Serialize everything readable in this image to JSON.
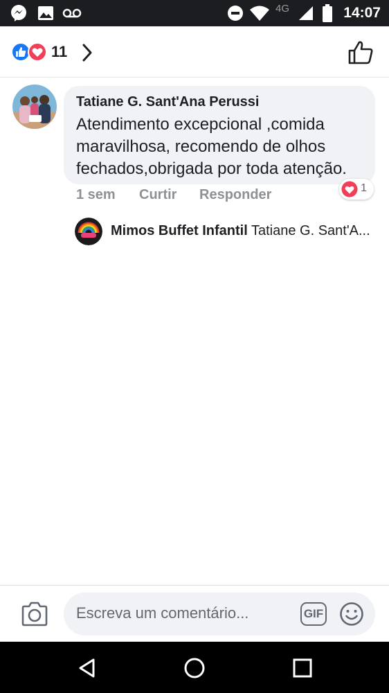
{
  "status_bar": {
    "time": "14:07",
    "network": "4G",
    "icons": [
      "messenger-icon",
      "image-icon",
      "voicemail-icon",
      "do-not-disturb-icon",
      "wifi-icon",
      "signal-icon",
      "battery-icon"
    ]
  },
  "header": {
    "reaction_icons": [
      "like-icon",
      "love-icon"
    ],
    "reaction_count": "11"
  },
  "comment": {
    "author": "Tatiane G. Sant'Ana Perussi",
    "text": "Atendimento excepcional ,comida maravilhosa, recomendo de olhos fechados,obrigada por toda atenção.",
    "time": "1 sem",
    "like_label": "Curtir",
    "reply_label": "Responder",
    "reaction_count": "1"
  },
  "reply": {
    "author": "Mimos Buffet Infantil",
    "text": "Tatiane G. Sant'A..."
  },
  "composer": {
    "placeholder": "Escreva um comentário...",
    "gif_label": "GIF"
  },
  "colors": {
    "status_bar_bg": "#1c1d20",
    "facebook_blue": "#1877f2",
    "love_red": "#f33e58",
    "bubble_bg": "#f0f2f5",
    "meta_gray": "#8d9196"
  }
}
